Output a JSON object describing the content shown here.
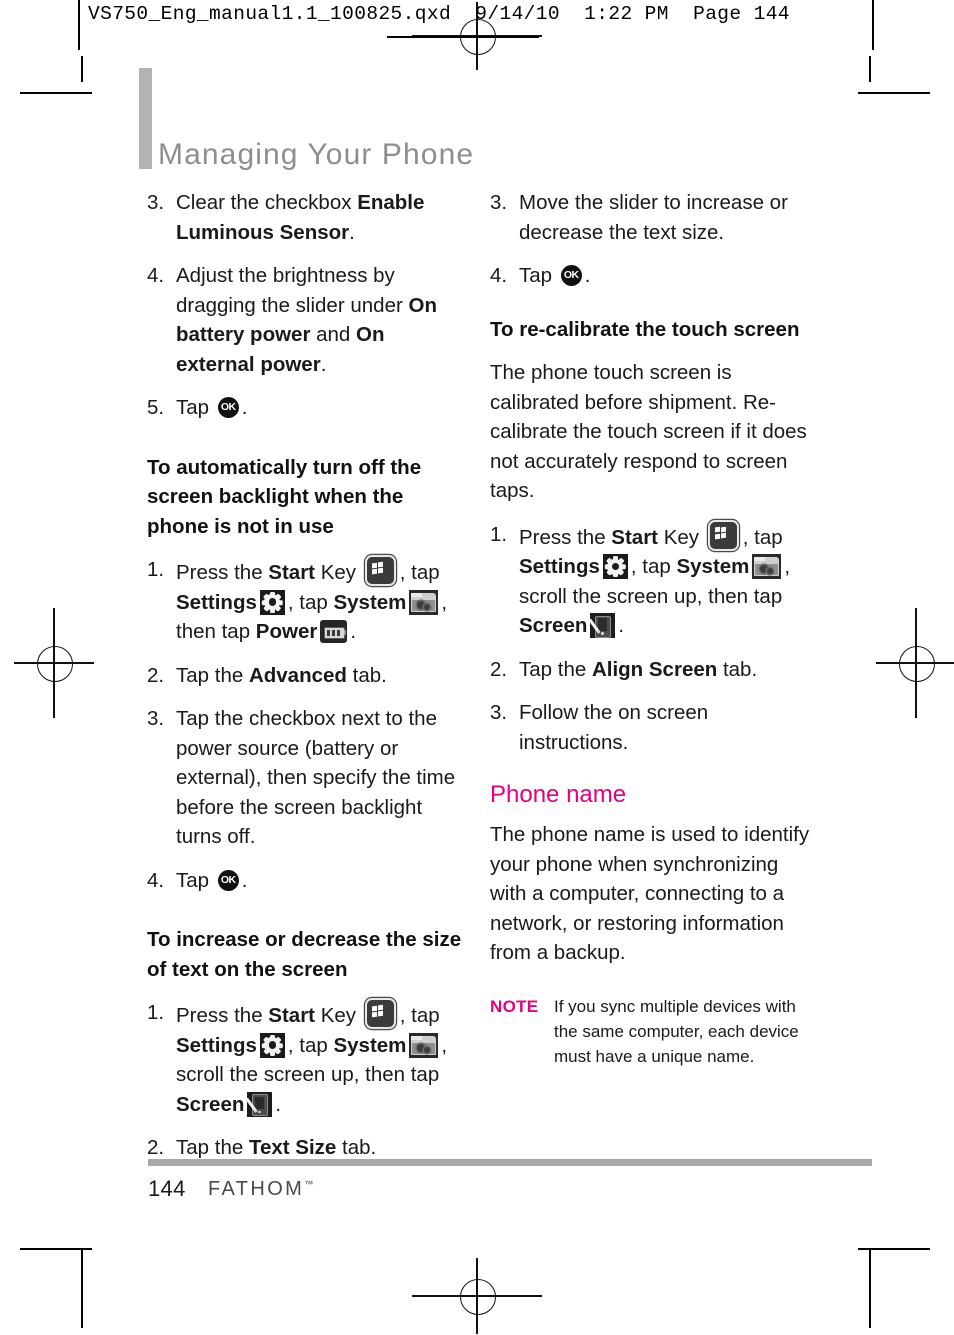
{
  "slug": {
    "text": "VS750_Eng_manual1.1_100825.qxd  9/14/10  1:22 PM  Page 144"
  },
  "header": {
    "chapter_title": "Managing Your Phone"
  },
  "colors": {
    "accent_magenta": "#e5007d",
    "title_gray": "#8e8e8e",
    "rule_gray": "#a8a8a8"
  },
  "icons": {
    "ok": "OK",
    "start": "start-key-icon",
    "settings": "settings-gear-icon",
    "system": "system-folder-icon",
    "power": "power-battery-icon",
    "screen": "screen-stylus-icon"
  },
  "left_column": {
    "step3": {
      "num": "3.",
      "t1": "Clear the checkbox ",
      "b1": "Enable Luminous Sensor",
      "t2": "."
    },
    "step4": {
      "num": "4.",
      "t1": "Adjust the brightness by dragging the slider under ",
      "b1": "On battery power",
      "t2": " and ",
      "b2": "On external power",
      "t3": "."
    },
    "step5": {
      "num": "5.",
      "t1": "Tap ",
      "t2": "."
    },
    "subhead1": "To automatically turn off the screen backlight when the phone is not in use",
    "s1_step1": {
      "num": "1.",
      "t1": "Press the ",
      "b1": "Start",
      "t2": " Key ",
      "t3": ", tap ",
      "b2": "Settings",
      "t4": ", tap ",
      "b3": "System",
      "t5": ", then tap ",
      "b4": "Power",
      "t6": "."
    },
    "s1_step2": {
      "num": "2.",
      "t1": "Tap the ",
      "b1": "Advanced",
      "t2": " tab."
    },
    "s1_step3": {
      "num": "3.",
      "t1": "Tap the checkbox next to the power source (battery or external), then specify the time before the screen backlight turns off."
    },
    "s1_step4": {
      "num": "4.",
      "t1": "Tap ",
      "t2": "."
    },
    "subhead2": "To increase or decrease the size of text on the screen",
    "s2_step1": {
      "num": "1.",
      "t1": "Press the ",
      "b1": "Start",
      "t2": " Key ",
      "t3": ", tap ",
      "b2": "Settings",
      "t4": ", tap ",
      "b3": "System",
      "t5": ", scroll the screen up, then tap ",
      "b4": "Screen",
      "t6": "."
    },
    "s2_step2": {
      "num": "2.",
      "t1": "Tap the ",
      "b1": "Text Size",
      "t2": " tab."
    }
  },
  "right_column": {
    "step3": {
      "num": "3.",
      "t1": "Move the slider to increase or decrease the text size."
    },
    "step4": {
      "num": "4.",
      "t1": "Tap ",
      "t2": "."
    },
    "subhead1": "To re-calibrate the touch screen",
    "para1": "The phone touch screen is calibrated before shipment. Re-calibrate the touch screen if it does not accurately respond to screen taps.",
    "r1_step1": {
      "num": "1.",
      "t1": "Press the ",
      "b1": "Start",
      "t2": " Key ",
      "t3": ", tap ",
      "b2": "Settings",
      "t4": ", tap ",
      "b3": "System",
      "t5": ", scroll the screen up, then tap ",
      "b4": "Screen",
      "t6": "."
    },
    "r1_step2": {
      "num": "2.",
      "t1": "Tap the ",
      "b1": "Align Screen",
      "t2": " tab."
    },
    "r1_step3": {
      "num": "3.",
      "t1": "Follow the on screen instructions."
    },
    "section_head": "Phone name",
    "para2": "The phone name is used to identify your phone when synchronizing with a computer, connecting to a network, or restoring information from a backup.",
    "note": {
      "label": "NOTE",
      "text": "If you sync multiple devices with the same computer, each device must have a unique name."
    }
  },
  "footer": {
    "page_number": "144",
    "brand": "FATHOM",
    "trademark": "™"
  }
}
